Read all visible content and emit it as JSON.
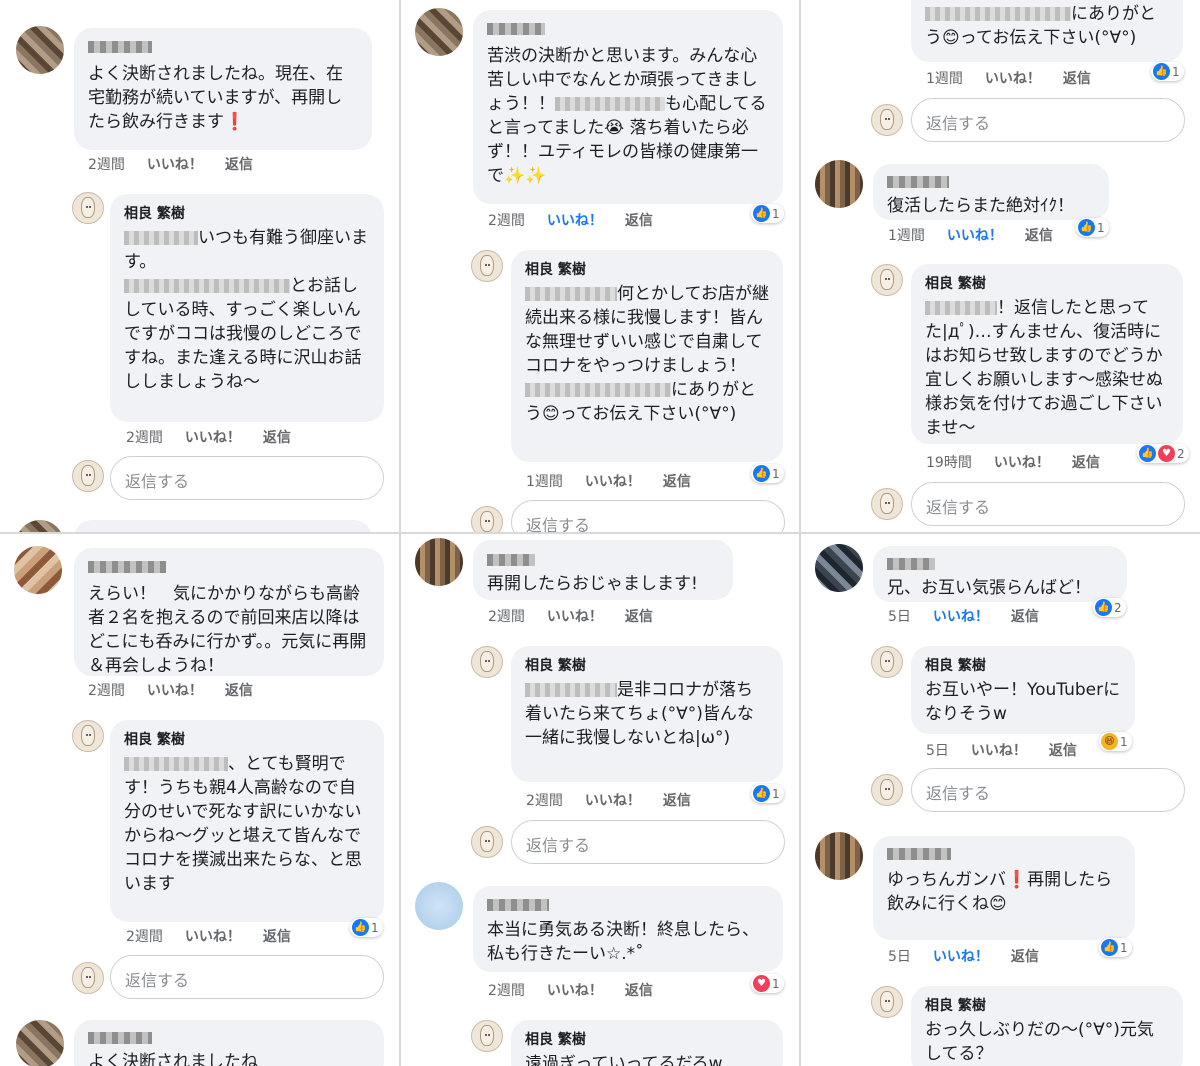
{
  "actions": {
    "like": "いいね！",
    "reply": "返信"
  },
  "reply_placeholder": "返信する",
  "panels": [
    {
      "id": "p1",
      "comments": [
        {
          "text": "よく決断されましたね。現在、在宅勤務が続いていますが、再開したら飲み行きます❗",
          "time": "2週間"
        },
        {
          "name": "相良 繁樹",
          "text_a": "いつも有難う御座います。",
          "text_b": "とお話ししている時、すっごく楽しいんですがココは我慢のしどころですね。また逢える時に沢山お話ししましょうね〜",
          "time": "2週間"
        }
      ]
    },
    {
      "id": "p2",
      "comments": [
        {
          "text_a": "苦渋の決断かと思います。みんな心苦しい中でなんとか頑張ってきましょう！！",
          "text_b": "も心配してると言ってました😭 落ち着いたら必ず！！ユティモレの皆様の健康第一で✨✨",
          "time": "2週間",
          "react": "1"
        },
        {
          "name": "相良 繁樹",
          "text_a": "何とかしてお店が継続出来る様に我慢します！皆んな無理せずいい感じで自粛してコロナをやっつけましょう！",
          "text_b": "にありがとう😊ってお伝え下さい(°∀°)",
          "time": "1週間",
          "react": "1"
        }
      ]
    },
    {
      "id": "p3",
      "comments": [
        {
          "text_top": "にありがとう😊ってお伝え下さい(°∀°)",
          "time": "1週間",
          "react": "1"
        },
        {
          "text": "復活したらまた絶対ｲｸ！",
          "time": "1週間",
          "react": "1"
        },
        {
          "name": "相良 繁樹",
          "text_a": "！返信したと思ってた|дﾟ)…すんません、復活時にはお知らせ致しますのでどうか宜しくお願いします〜感染せぬ様お気を付けてお過ごし下さいませ〜",
          "time": "19時間",
          "react": "2"
        }
      ]
    },
    {
      "id": "p4",
      "comments": [
        {
          "text": "えらい！　気にかかりながらも高齢者２名を抱えるので前回来店以降はどこにも呑みに行かず。。元気に再開＆再会しようね！",
          "time": "2週間"
        },
        {
          "name": "相良 繁樹",
          "text_a": "、とても賢明です！うちも親4人高齢なので自分のせいで死なす訳にいかないからね〜グッと堪えて皆んなでコロナを撲滅出来たらな、と思います",
          "time": "2週間",
          "react": "1"
        },
        {
          "text": "よく決断されましたね"
        }
      ]
    },
    {
      "id": "p5",
      "comments": [
        {
          "text": "再開したらおじゃまします!",
          "time": "2週間"
        },
        {
          "name": "相良 繁樹",
          "text_a": "是非コロナが落ち着いたら来てちょ(°∀°)皆んな一緒に我慢しないとね|ω°)",
          "time": "2週間",
          "react": "1"
        },
        {
          "text": "本当に勇気ある決断！終息したら、私も行きたーい☆.*˚",
          "time": "2週間",
          "react": "1"
        },
        {
          "name": "相良 繁樹",
          "text_a": "遠過ぎっていってるだろw"
        }
      ]
    },
    {
      "id": "p6",
      "comments": [
        {
          "text": "兄、お互い気張らんばど！",
          "time": "5日",
          "react": "2"
        },
        {
          "name": "相良 繁樹",
          "text_a": "お互いやー！YouTuberになりそうw",
          "time": "5日",
          "react": "1"
        },
        {
          "text": "ゆっちんガンバ❗再開したら飲みに行くね😊",
          "time": "5日",
          "react": "1"
        },
        {
          "name": "相良 繁樹",
          "text_a": "おっ久しぶりだの〜(°∀°)元気してる？"
        }
      ]
    }
  ]
}
